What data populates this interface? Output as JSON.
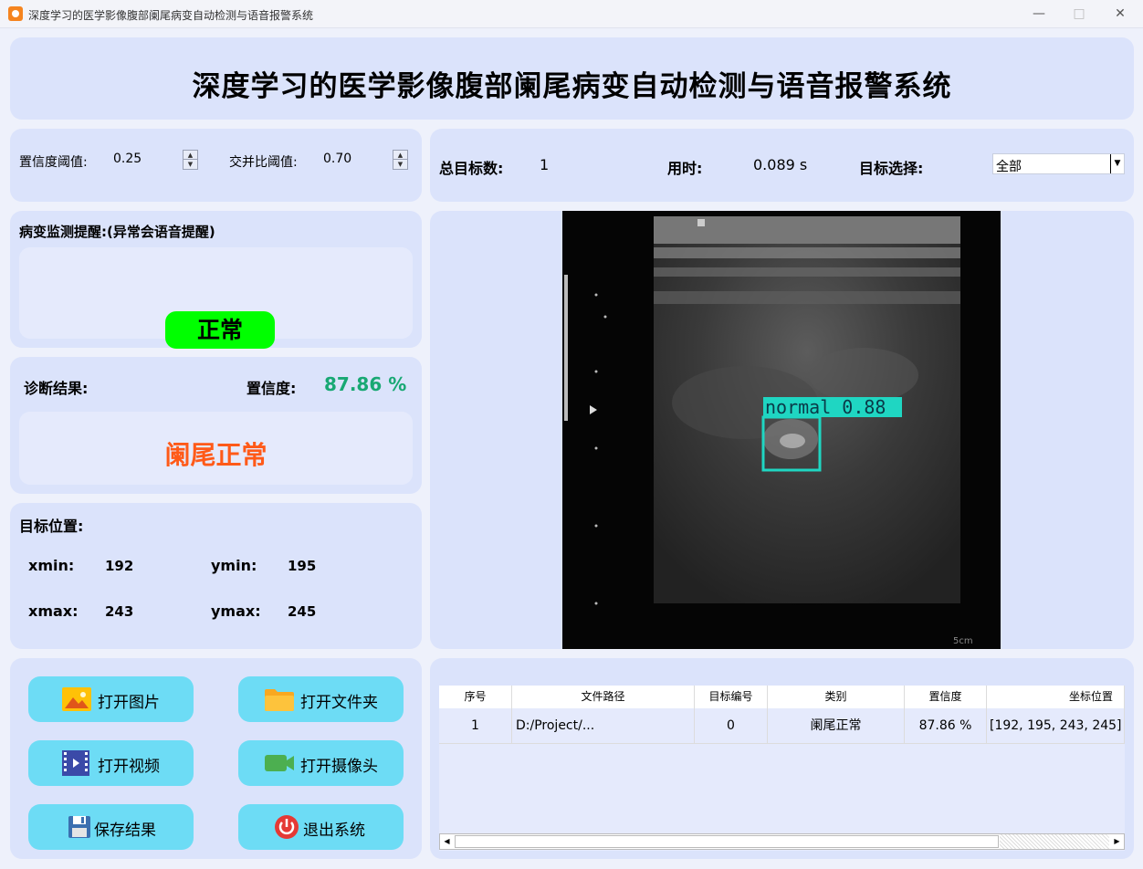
{
  "window": {
    "title": "深度学习的医学影像腹部阑尾病变自动检测与语音报警系统",
    "minimize_icon": "minimize-icon",
    "maximize_icon": "maximize-icon",
    "close_icon": "close-icon"
  },
  "header": {
    "title": "深度学习的医学影像腹部阑尾病变自动检测与语音报警系统"
  },
  "thresholds": {
    "conf_label": "置信度阈值:",
    "conf_value": "0.25",
    "iou_label": "交并比阈值:",
    "iou_value": "0.70"
  },
  "stats": {
    "total_label": "总目标数:",
    "total_value": "1",
    "time_label": "用时:",
    "time_value": "0.089 s",
    "select_label": "目标选择:",
    "select_value": "全部"
  },
  "monitor": {
    "label": "病变监测提醒:(异常会语音提醒)",
    "status": "正常",
    "status_color": "#00ff00"
  },
  "diagnosis": {
    "label": "诊断结果:",
    "conf_label": "置信度:",
    "conf_value": "87.86 %",
    "result": "阑尾正常",
    "result_color": "#ff5a18",
    "conf_color": "#18a873"
  },
  "position": {
    "label": "目标位置:",
    "xmin_label": "xmin:",
    "xmin": "192",
    "ymin_label": "ymin:",
    "ymin": "195",
    "xmax_label": "xmax:",
    "xmax": "243",
    "ymax_label": "ymax:",
    "ymax": "245"
  },
  "buttons": {
    "open_image": "打开图片",
    "open_folder": "打开文件夹",
    "open_video": "打开视频",
    "open_camera": "打开摄像头",
    "save": "保存结果",
    "exit": "退出系统"
  },
  "image": {
    "detection_label": "normal  0.88",
    "box_color": "#1fd6c2"
  },
  "table": {
    "headers": [
      "序号",
      "文件路径",
      "目标编号",
      "类别",
      "置信度",
      "坐标位置"
    ],
    "rows": [
      [
        "1",
        "D:/Project/...",
        "0",
        "阑尾正常",
        "87.86 %",
        "[192, 195, 243, 245]"
      ]
    ]
  }
}
